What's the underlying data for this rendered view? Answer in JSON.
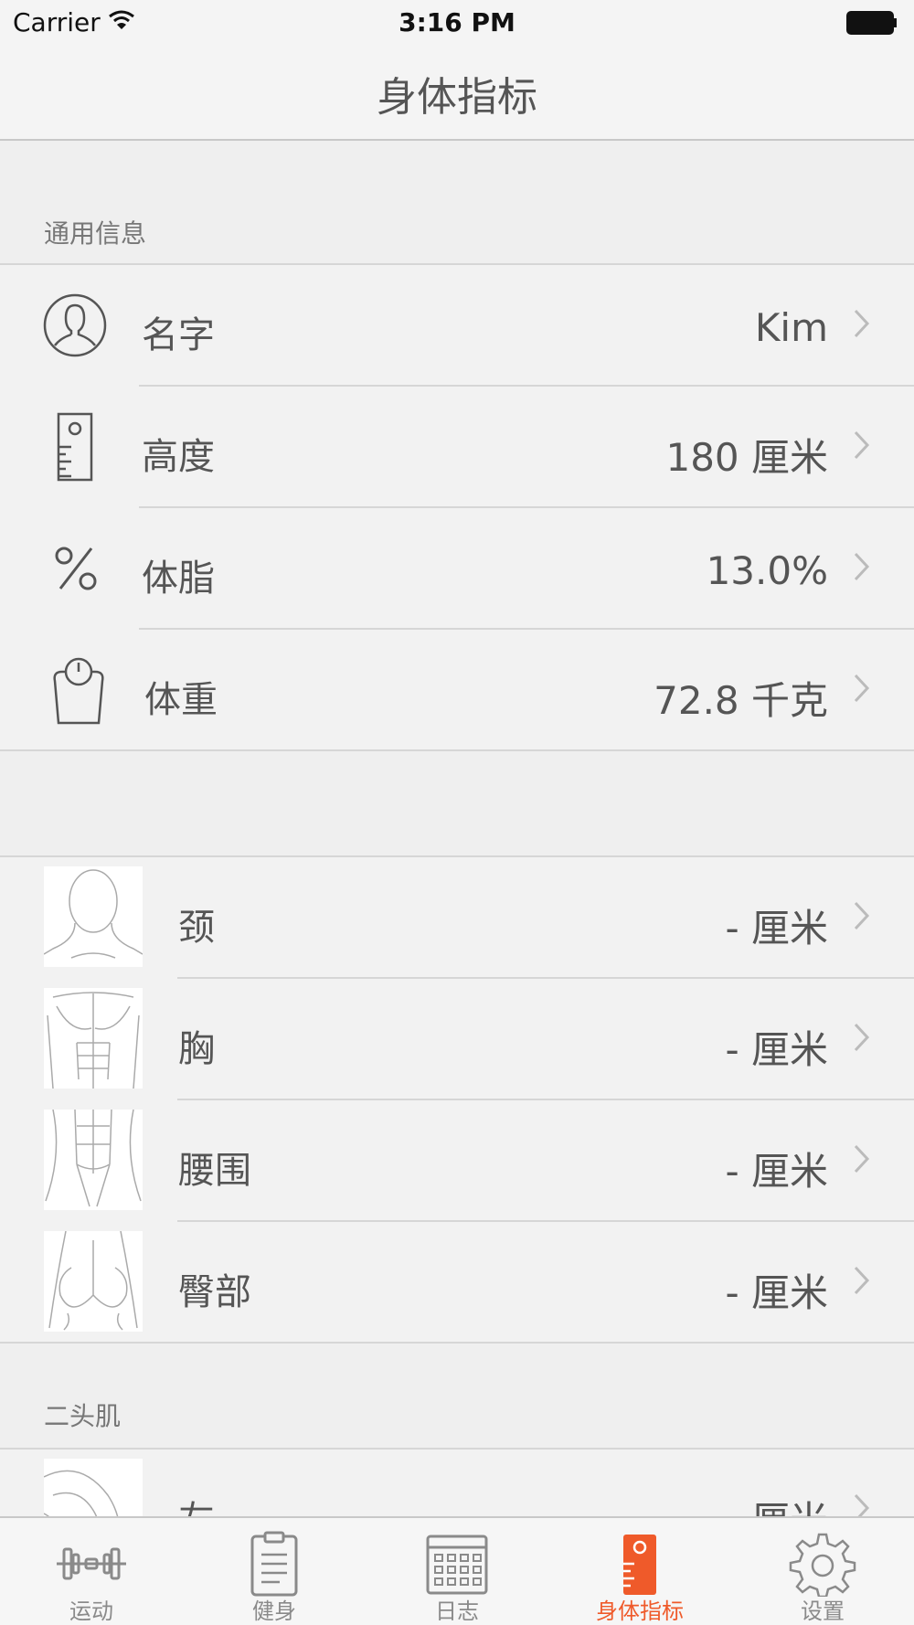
{
  "status_bar": {
    "carrier": "Carrier",
    "time": "3:16 PM"
  },
  "nav": {
    "title": "身体指标"
  },
  "general": {
    "header": "通用信息",
    "rows": [
      {
        "label": "名字",
        "value": "Kim",
        "icon": "person-icon"
      },
      {
        "label": "高度",
        "value": "180 厘米",
        "icon": "ruler-icon"
      },
      {
        "label": "体脂",
        "value": "13.0%",
        "icon": "percent-icon"
      },
      {
        "label": "体重",
        "value": "72.8 千克",
        "icon": "scale-icon"
      }
    ]
  },
  "body": {
    "rows": [
      {
        "label": "颈",
        "value": "- 厘米",
        "icon": "neck-image"
      },
      {
        "label": "胸",
        "value": "- 厘米",
        "icon": "chest-image"
      },
      {
        "label": "腰围",
        "value": "- 厘米",
        "icon": "waist-image"
      },
      {
        "label": "臀部",
        "value": "- 厘米",
        "icon": "hips-image"
      }
    ]
  },
  "biceps": {
    "header": "二头肌",
    "rows": [
      {
        "label": "左",
        "value": "- 厘米",
        "icon": "bicep-image"
      }
    ]
  },
  "tabs": [
    {
      "label": "运动",
      "icon": "dumbbell-icon"
    },
    {
      "label": "健身",
      "icon": "clipboard-icon"
    },
    {
      "label": "日志",
      "icon": "calendar-icon"
    },
    {
      "label": "身体指标",
      "icon": "body-metrics-icon",
      "active": true
    },
    {
      "label": "设置",
      "icon": "gear-icon"
    }
  ],
  "colors": {
    "accent": "#ef5a2a",
    "text": "#555555",
    "background": "#efefef"
  }
}
